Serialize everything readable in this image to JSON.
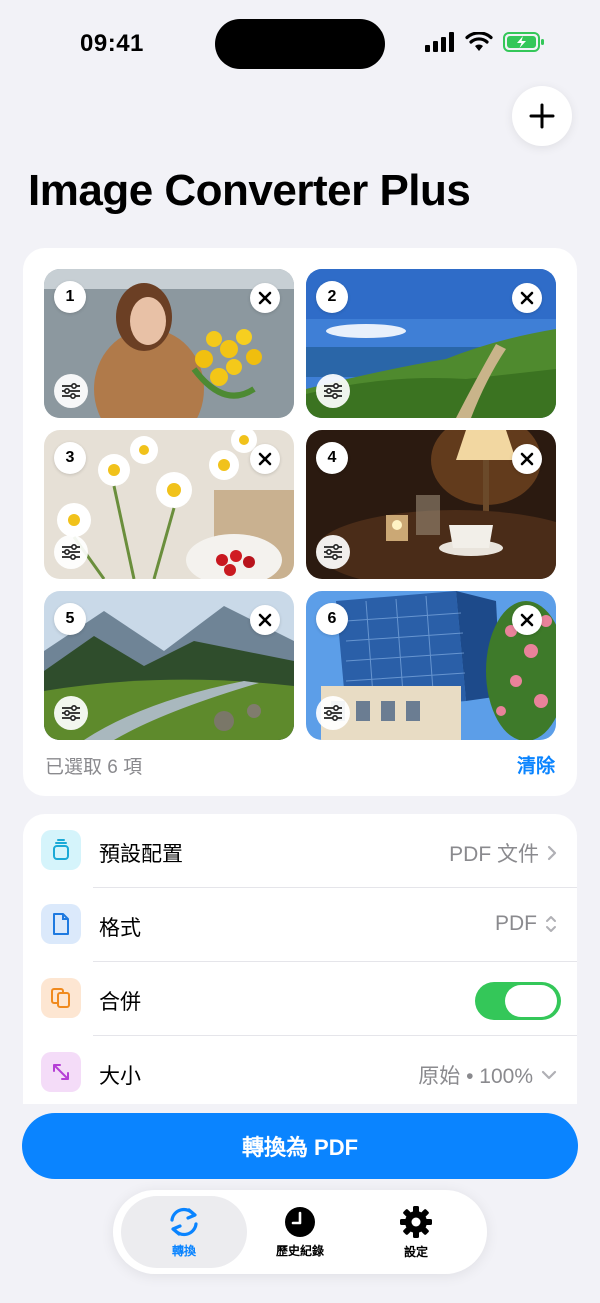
{
  "status_bar": {
    "time": "09:41"
  },
  "header": {
    "title": "Image Converter Plus"
  },
  "images": [
    {
      "index": "1"
    },
    {
      "index": "2"
    },
    {
      "index": "3"
    },
    {
      "index": "4"
    },
    {
      "index": "5"
    },
    {
      "index": "6"
    }
  ],
  "selection": {
    "count_text": "已選取 6 項",
    "clear_label": "清除"
  },
  "settings": {
    "preset": {
      "label": "預設配置",
      "value": "PDF 文件"
    },
    "format": {
      "label": "格式",
      "value": "PDF"
    },
    "merge": {
      "label": "合併",
      "on": true
    },
    "size": {
      "label": "大小",
      "value": "原始 • 100%"
    }
  },
  "convert_button": {
    "label": "轉換為 PDF"
  },
  "tabs": [
    {
      "label": "轉換",
      "icon": "convert-icon",
      "active": true
    },
    {
      "label": "歷史紀錄",
      "icon": "clock-icon",
      "active": false
    },
    {
      "label": "設定",
      "icon": "gear-icon",
      "active": false
    }
  ],
  "colors": {
    "accent": "#0a84ff",
    "toggle_on": "#34c759",
    "background": "#f2f2f7"
  }
}
